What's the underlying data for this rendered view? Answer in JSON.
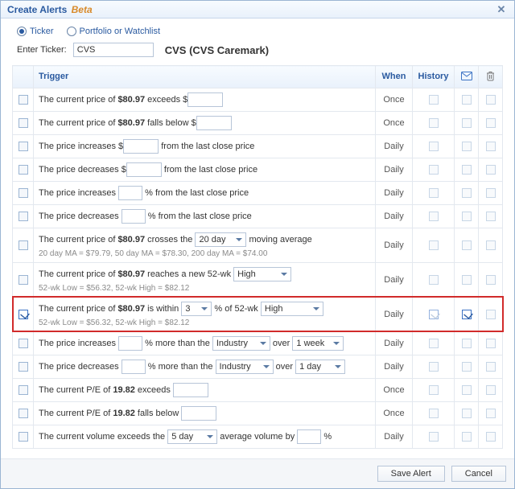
{
  "title": {
    "main": "Create Alerts",
    "badge": "Beta"
  },
  "mode": {
    "options": [
      {
        "label": "Ticker",
        "checked": true
      },
      {
        "label": "Portfolio or Watchlist",
        "checked": false
      }
    ]
  },
  "ticker": {
    "label": "Enter Ticker:",
    "value": "CVS",
    "display_name": "CVS (CVS Caremark)"
  },
  "columns": {
    "trigger": "Trigger",
    "when": "When",
    "history": "History",
    "mail_icon": "mail-icon",
    "trash_icon": "trash-icon"
  },
  "price": "$80.97",
  "pe": "19.82",
  "rows": [
    {
      "checked": false,
      "when": "Once",
      "segments": [
        "The current price of ",
        "PRICE",
        " exceeds $"
      ],
      "inputs": [
        "text:mini"
      ],
      "tail": ""
    },
    {
      "checked": false,
      "when": "Once",
      "segments": [
        "The current price of ",
        "PRICE",
        " falls below $"
      ],
      "inputs": [
        "text:mini"
      ],
      "tail": ""
    },
    {
      "checked": false,
      "when": "Daily",
      "segments": [
        "The price increases $"
      ],
      "inputs": [
        "text:mini"
      ],
      "tail": " from the last close price"
    },
    {
      "checked": false,
      "when": "Daily",
      "segments": [
        "The price decreases $"
      ],
      "inputs": [
        "text:mini"
      ],
      "tail": " from the last close price"
    },
    {
      "checked": false,
      "when": "Daily",
      "segments": [
        "The price increases "
      ],
      "inputs": [
        "text:tiny"
      ],
      "tail": " % from the last close price"
    },
    {
      "checked": false,
      "when": "Daily",
      "segments": [
        "The price decreases "
      ],
      "inputs": [
        "text:tiny"
      ],
      "tail": " % from the last close price"
    },
    {
      "checked": false,
      "when": "Daily",
      "segments": [
        "The current price of ",
        "PRICE",
        " crosses the "
      ],
      "inputs": [
        "select:20 day:w64"
      ],
      "tail": " moving average",
      "sub": "20 day MA = $79.79, 50 day MA = $78.30, 200 day MA = $74.00"
    },
    {
      "checked": false,
      "when": "Daily",
      "segments": [
        "The current price of ",
        "PRICE",
        " reaches a new 52-wk "
      ],
      "inputs": [
        "select:High:w70"
      ],
      "tail": "",
      "sub": "52-wk Low = $56.32, 52-wk High = $82.12"
    },
    {
      "checked": true,
      "when": "Daily",
      "highlight": true,
      "mail_checked": true,
      "history_checked": true,
      "segments": [
        "The current price of ",
        "PRICE",
        " is within "
      ],
      "inputs": [
        "select:3:w34",
        "literal: % of 52-wk ",
        "select:High:w74"
      ],
      "tail": "",
      "sub": "52-wk Low = $56.32, 52-wk High = $82.12"
    },
    {
      "checked": false,
      "when": "Daily",
      "segments": [
        "The price increases "
      ],
      "inputs": [
        "text:tiny",
        "literal: % more than the ",
        "select:Industry:w70",
        "literal: over ",
        "select:1 week:w64"
      ],
      "tail": ""
    },
    {
      "checked": false,
      "when": "Daily",
      "segments": [
        "The price decreases "
      ],
      "inputs": [
        "text:tiny",
        "literal: % more than the ",
        "select:Industry:w70",
        "literal: over ",
        "select:1 day:w60"
      ],
      "tail": ""
    },
    {
      "checked": false,
      "when": "Once",
      "segments": [
        "The current P/E of ",
        "PE",
        " exceeds "
      ],
      "inputs": [
        "text:mini"
      ],
      "tail": ""
    },
    {
      "checked": false,
      "when": "Once",
      "segments": [
        "The current P/E of ",
        "PE",
        " falls below "
      ],
      "inputs": [
        "text:mini"
      ],
      "tail": ""
    },
    {
      "checked": false,
      "when": "Daily",
      "segments": [
        "The current volume exceeds the "
      ],
      "inputs": [
        "select:5 day:w60",
        "literal: average volume by ",
        "text:tiny"
      ],
      "tail": " %"
    }
  ],
  "footer": {
    "save": "Save Alert",
    "cancel": "Cancel"
  }
}
